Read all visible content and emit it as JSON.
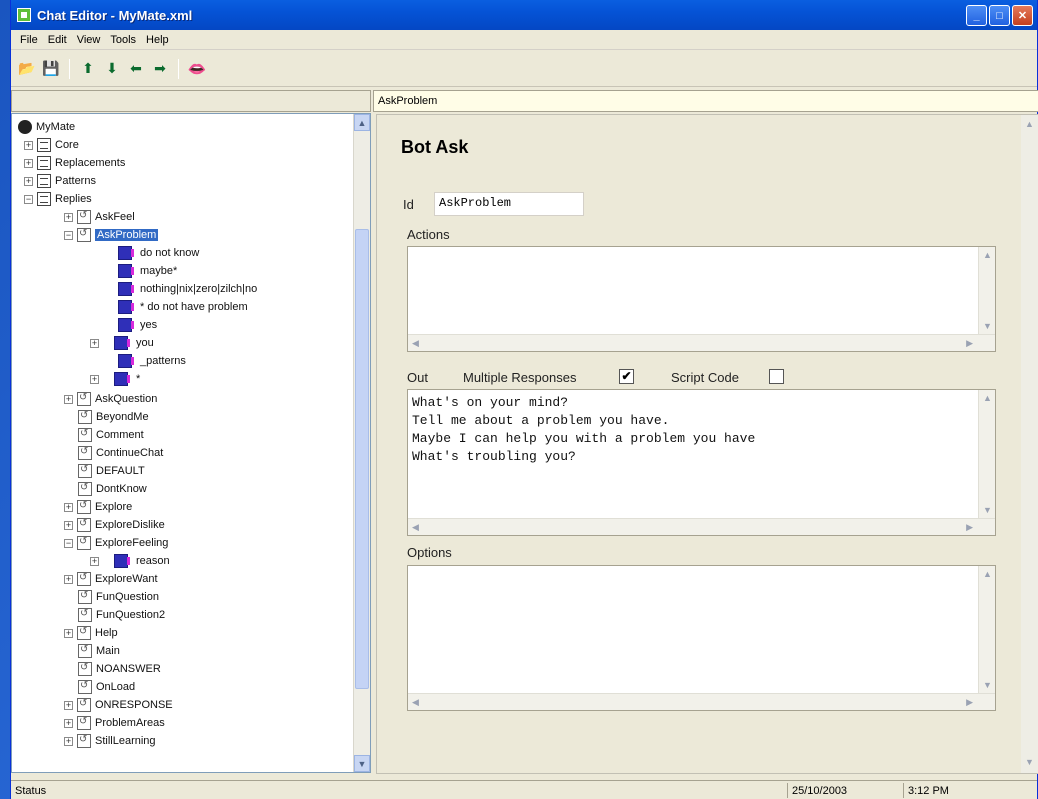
{
  "window": {
    "title": "Chat Editor - MyMate.xml",
    "buttons": {
      "minimize": "_",
      "maximize": "□",
      "close": "✕"
    }
  },
  "menu": [
    "File",
    "Edit",
    "View",
    "Tools",
    "Help"
  ],
  "toolbar": {
    "open_icon": "📂",
    "save_icon": "💾",
    "up_icon": "⬆",
    "down_icon": "⬇",
    "left_icon": "⬅",
    "right_icon": "➡",
    "lips_icon": "👄"
  },
  "tree": {
    "root": "MyMate",
    "items": [
      {
        "label": "Core"
      },
      {
        "label": "Replacements"
      },
      {
        "label": "Patterns"
      },
      {
        "label": "Replies"
      },
      {
        "label": "AskFeel"
      },
      {
        "label": "AskProblem"
      },
      {
        "label": "do not know"
      },
      {
        "label": "maybe*"
      },
      {
        "label": "nothing|nix|zero|zilch|no"
      },
      {
        "label": "* do not have problem"
      },
      {
        "label": "yes"
      },
      {
        "label": "you"
      },
      {
        "label": "_patterns"
      },
      {
        "label": "*"
      },
      {
        "label": "AskQuestion"
      },
      {
        "label": "BeyondMe"
      },
      {
        "label": "Comment"
      },
      {
        "label": "ContinueChat"
      },
      {
        "label": "DEFAULT"
      },
      {
        "label": "DontKnow"
      },
      {
        "label": "Explore"
      },
      {
        "label": "ExploreDislike"
      },
      {
        "label": "ExploreFeeling"
      },
      {
        "label": "reason"
      },
      {
        "label": "ExploreWant"
      },
      {
        "label": "FunQuestion"
      },
      {
        "label": "FunQuestion2"
      },
      {
        "label": "Help"
      },
      {
        "label": "Main"
      },
      {
        "label": "NOANSWER"
      },
      {
        "label": "OnLoad"
      },
      {
        "label": "ONRESPONSE"
      },
      {
        "label": "ProblemAreas"
      },
      {
        "label": "StillLearning"
      }
    ],
    "scroll_up": "▲",
    "scroll_down": "▼"
  },
  "detail": {
    "header": "AskProblem",
    "title": "Bot Ask",
    "id_label": "Id",
    "id_value": "AskProblem",
    "actions_label": "Actions",
    "out_label": "Out",
    "multiple_responses_label": "Multiple Responses",
    "multiple_responses_checked": "✔",
    "script_code_label": "Script Code",
    "script_code_checked": "",
    "out_lines": "What's on your mind?\nTell me about a problem you have.\nMaybe I can help you with a problem you have\nWhat's troubling you?",
    "options_label": "Options",
    "scroll_up": "▲",
    "scroll_down": "▼",
    "scroll_left": "◀",
    "scroll_right": "▶"
  },
  "status": {
    "text": "Status",
    "date": "25/10/2003",
    "time": "3:12 PM"
  }
}
